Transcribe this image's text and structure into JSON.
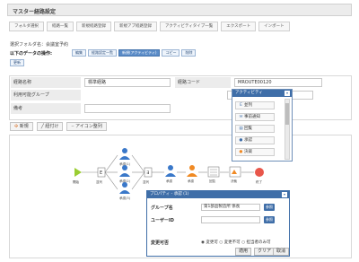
{
  "page": {
    "title": "マスター経路設定"
  },
  "tabs": [
    "フォルダ選択",
    "経路一覧",
    "新規経路登録",
    "新規アプ経路登録",
    "アクティビティタイプ一覧",
    "エクスポート",
    "インポート"
  ],
  "info": {
    "folder_line": "選択フォルダ名：会議室予約",
    "ops_label": "以下のデータの操作:",
    "ops": [
      "編集",
      "経路設定一覧",
      "新規(アクティビティ)",
      "コピー",
      "削除"
    ],
    "selected_op": "新規(アクティビティ)",
    "revert_label": "更新"
  },
  "form": {
    "route_name_label": "経路名称",
    "route_name_value": "標準経路",
    "route_code_label": "経路コード",
    "route_code_value": "MROUTE00120",
    "group_label": "利用可能グループ",
    "group_value": "",
    "note_label": "備考",
    "note_value": ""
  },
  "toolbar": {
    "new_label": "新規",
    "connect_label": "紐付け",
    "align_label": "アイコン整列"
  },
  "palette": {
    "title": "アクティビティ",
    "items": [
      "並列",
      "事前通知",
      "回覧",
      "承認",
      "決裁"
    ],
    "icons": [
      "parallel-icon",
      "notify-icon",
      "circulation-icon",
      "approval-icon",
      "decision-icon"
    ]
  },
  "flow": {
    "start_label": "開始",
    "end_label": "終了",
    "split_label": "並列",
    "join_label": "並列",
    "approvers": [
      "承認(1)",
      "承認(2)",
      "承認(3)"
    ],
    "chain": [
      "承認",
      "承認",
      "回覧",
      "決裁"
    ]
  },
  "props": {
    "title": "プロパティ - 承認 (1)",
    "group_label": "グループ名",
    "group_value": "第1部品製造所 係長",
    "ref_button": "参照",
    "user_label": "ユーザーID",
    "user_value": "",
    "change_label": "変更可否",
    "radio_options": [
      "変更可",
      "変更不可",
      "担当者のみ可"
    ],
    "apply_label": "適用",
    "clear_label": "クリア",
    "cancel_label": "取消"
  },
  "colors": {
    "header_blue": "#3f6ea8",
    "start_green": "#9acd32",
    "person_blue": "#3a78c9",
    "person_orange": "#f08a24",
    "end_red": "#e8564a"
  }
}
